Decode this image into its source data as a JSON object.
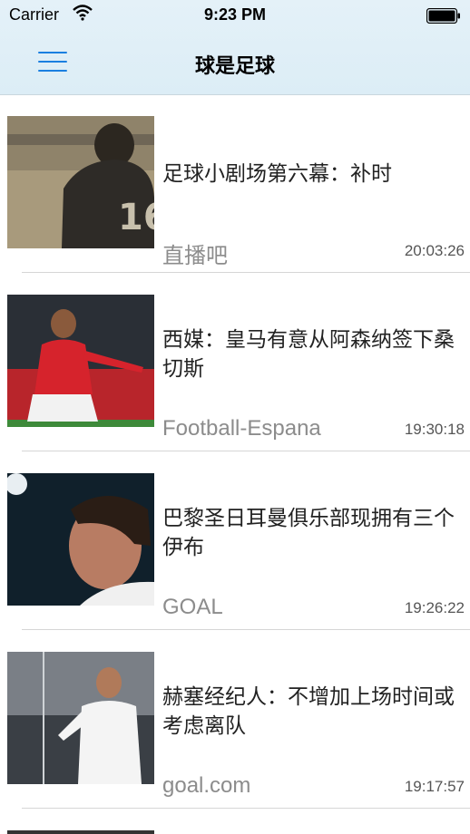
{
  "status_bar": {
    "carrier": "Carrier",
    "time": "9:23 PM"
  },
  "nav": {
    "title": "球是足球"
  },
  "news": [
    {
      "title": "足球小剧场第六幕：补时",
      "source": "直播吧",
      "time": "20:03:26"
    },
    {
      "title": "西媒：皇马有意从阿森纳签下桑切斯",
      "source": "Football-Espana",
      "time": "19:30:18"
    },
    {
      "title": "巴黎圣日耳曼俱乐部现拥有三个伊布",
      "source": "GOAL",
      "time": "19:26:22"
    },
    {
      "title": "赫塞经纪人：不增加上场时间或考虑离队",
      "source": "goal.com",
      "time": "19:17:57"
    }
  ],
  "colors": {
    "accent": "#1a7fe0",
    "header_bg": "#dcedf6"
  }
}
